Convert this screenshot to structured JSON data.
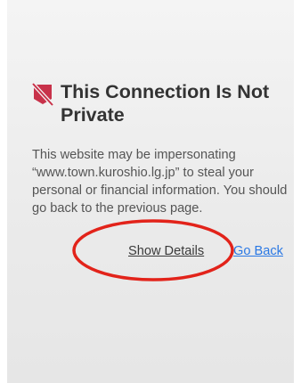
{
  "warning": {
    "icon": "not-private-warning-icon",
    "title": "This Connection Is Not Private",
    "message": "This website may be impersonating “www.town.kuroshio.lg.jp” to steal your personal or financial information. You should go back to the previous page."
  },
  "actions": {
    "show_details_label": "Show Details",
    "go_back_label": "Go Back"
  },
  "colors": {
    "icon": "#c8324a",
    "title": "#333333",
    "body_text": "#555555",
    "link": "#2a78e4",
    "annotation_circle": "#e2231a"
  }
}
